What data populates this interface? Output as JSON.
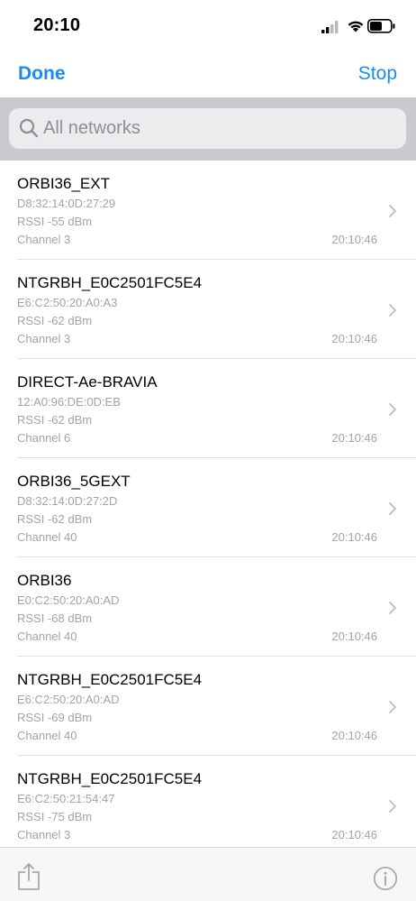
{
  "status_bar": {
    "time": "20:10",
    "icons": [
      "signal-icon",
      "wifi-icon",
      "battery-icon"
    ]
  },
  "nav": {
    "done_label": "Done",
    "stop_label": "Stop",
    "accent_color": "#1a8cf0"
  },
  "search": {
    "placeholder": "All networks",
    "value": ""
  },
  "networks": [
    {
      "name": "ORBI36_EXT",
      "mac": "D8:32:14:0D:27:29",
      "rssi": "RSSI -55 dBm",
      "channel": "Channel 3",
      "time": "20:10:46"
    },
    {
      "name": "NTGRBH_E0C2501FC5E4",
      "mac": "E6:C2:50:20:A0:A3",
      "rssi": "RSSI -62 dBm",
      "channel": "Channel 3",
      "time": "20:10:46"
    },
    {
      "name": "DIRECT-Ae-BRAVIA",
      "mac": "12:A0:96:DE:0D:EB",
      "rssi": "RSSI -62 dBm",
      "channel": "Channel 6",
      "time": "20:10:46"
    },
    {
      "name": "ORBI36_5GEXT",
      "mac": "D8:32:14:0D:27:2D",
      "rssi": "RSSI -62 dBm",
      "channel": "Channel 40",
      "time": "20:10:46"
    },
    {
      "name": "ORBI36",
      "mac": "E0:C2:50:20:A0:AD",
      "rssi": "RSSI -68 dBm",
      "channel": "Channel 40",
      "time": "20:10:46"
    },
    {
      "name": "NTGRBH_E0C2501FC5E4",
      "mac": "E6:C2:50:20:A0:AD",
      "rssi": "RSSI -69 dBm",
      "channel": "Channel 40",
      "time": "20:10:46"
    },
    {
      "name": "NTGRBH_E0C2501FC5E4",
      "mac": "E6:C2:50:21:54:47",
      "rssi": "RSSI -75 dBm",
      "channel": "Channel 3",
      "time": "20:10:46"
    }
  ],
  "toolbar": {
    "icons": [
      "share-icon",
      "info-icon"
    ]
  }
}
